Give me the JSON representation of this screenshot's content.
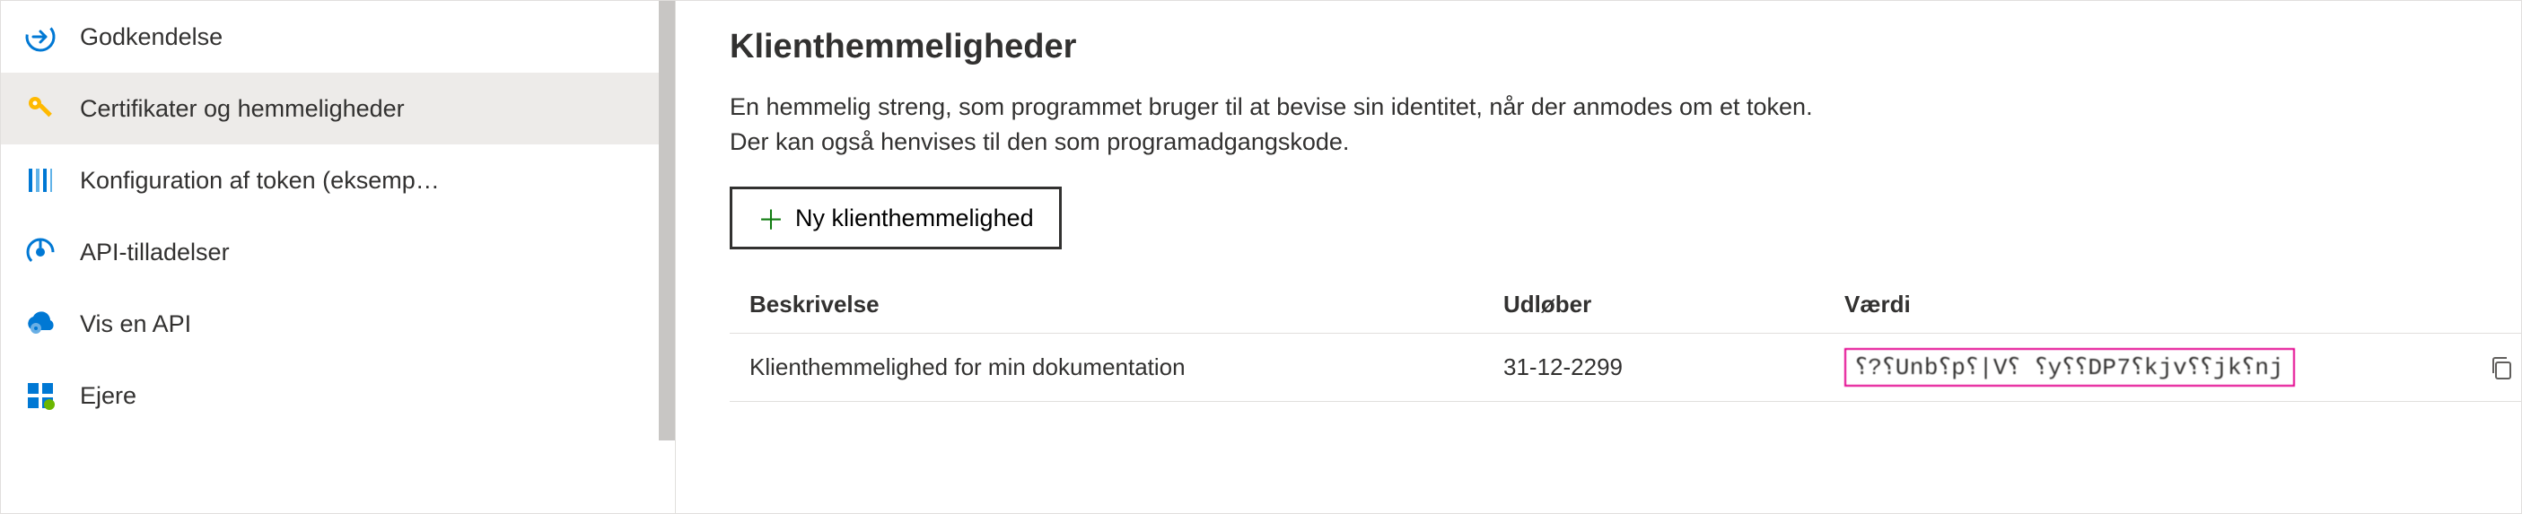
{
  "sidebar": {
    "items": [
      {
        "label": "Godkendelse",
        "icon": "auth"
      },
      {
        "label": "Certifikater og hemmeligheder",
        "icon": "key",
        "active": true
      },
      {
        "label": "Konfiguration af token (eksemp…",
        "icon": "token"
      },
      {
        "label": "API-tilladelser",
        "icon": "api-perm"
      },
      {
        "label": "Vis en API",
        "icon": "expose-api"
      },
      {
        "label": "Ejere",
        "icon": "owners"
      }
    ]
  },
  "main": {
    "title": "Klienthemmeligheder",
    "description_line1": "En hemmelig streng, som programmet bruger til at bevise sin identitet, når der anmodes om et token.",
    "description_line2": "Der kan også henvises til den som programadgangskode.",
    "new_secret_label": "Ny klienthemmelighed",
    "columns": {
      "description": "Beskrivelse",
      "expires": "Udløber",
      "value": "Værdi"
    },
    "rows": [
      {
        "description": "Klienthemmelighed for min dokumentation",
        "expires": "31-12-2299",
        "value": "⸮?⸮Unb⸮p⸮|V⸮ ⸮y⸮⸮DP7⸮kjv⸮⸮jk⸮nj"
      }
    ]
  }
}
